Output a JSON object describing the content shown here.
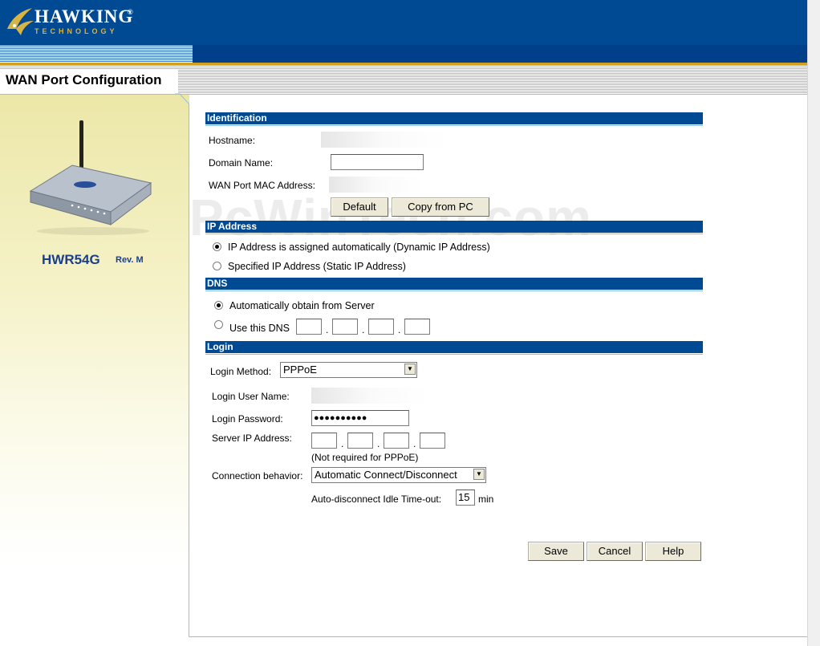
{
  "header": {
    "brand": "HAWKING",
    "brand_sub": "TECHNOLOGY",
    "brand_reg": "®",
    "page_title": "WAN Port Configuration"
  },
  "sidebar": {
    "model": "HWR54G",
    "revision": "Rev. M"
  },
  "watermark": "PcWinTech.com",
  "identification": {
    "section_title": "Identification",
    "hostname_label": "Hostname:",
    "hostname_value": "",
    "domain_label": "Domain Name:",
    "domain_value": "",
    "mac_label": "WAN Port MAC Address:",
    "mac_value": "",
    "default_button": "Default",
    "copy_button": "Copy from PC"
  },
  "ip_address": {
    "section_title": "IP Address",
    "option_dynamic": "IP Address is assigned automatically (Dynamic IP Address)",
    "option_static": "Specified IP Address (Static IP Address)",
    "selected": "dynamic"
  },
  "dns": {
    "section_title": "DNS",
    "option_auto": "Automatically obtain from Server",
    "option_manual": "Use this DNS",
    "selected": "auto",
    "octets": [
      "",
      "",
      "",
      ""
    ],
    "separator": "."
  },
  "login": {
    "section_title": "Login",
    "method_label": "Login Method:",
    "method_value": "PPPoE",
    "username_label": "Login User Name:",
    "username_value": "",
    "password_label": "Login Password:",
    "password_value": "●●●●●●●●●●",
    "server_ip_label": "Server IP Address:",
    "server_ip_octets": [
      "",
      "",
      "",
      ""
    ],
    "server_ip_note": "(Not required for PPPoE)",
    "behavior_label": "Connection behavior:",
    "behavior_value": "Automatic Connect/Disconnect",
    "idle_label": "Auto-disconnect Idle Time-out:",
    "idle_value": "15",
    "idle_unit": "min"
  },
  "actions": {
    "save": "Save",
    "cancel": "Cancel",
    "help": "Help"
  },
  "colors": {
    "header_blue": "#004a93",
    "gold": "#d4a020",
    "section_bar": "#004a93",
    "model_text": "#1a3f8c"
  }
}
